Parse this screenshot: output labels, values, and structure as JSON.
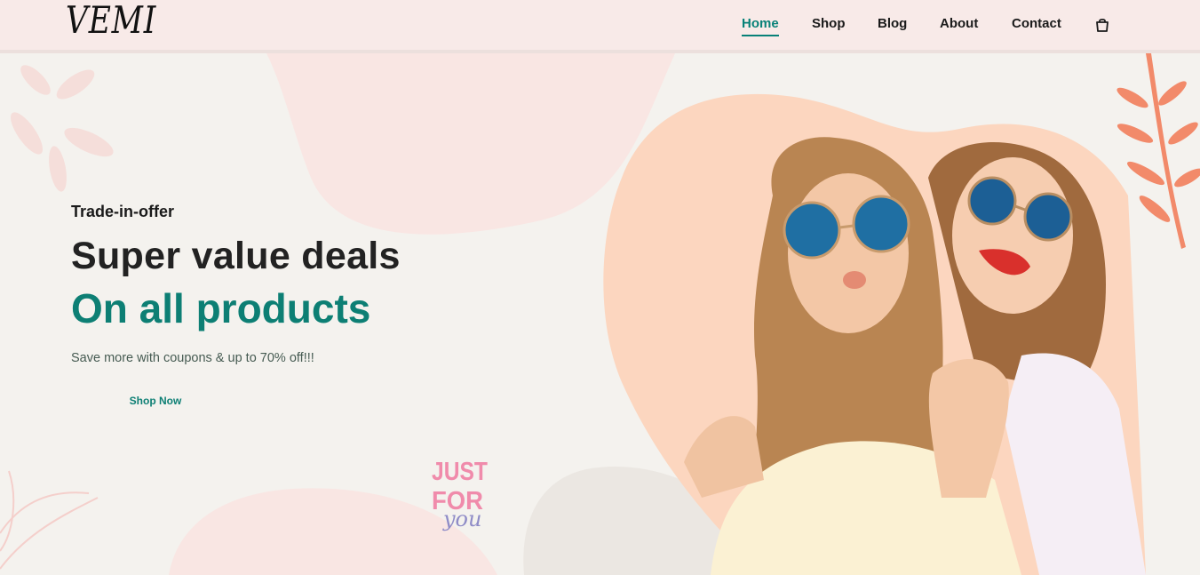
{
  "brand": {
    "logo_text": "VEMI"
  },
  "nav": {
    "items": [
      {
        "label": "Home",
        "active": true
      },
      {
        "label": "Shop",
        "active": false
      },
      {
        "label": "Blog",
        "active": false
      },
      {
        "label": "About",
        "active": false
      },
      {
        "label": "Contact",
        "active": false
      }
    ],
    "cart_icon": "shopping-bag-icon"
  },
  "hero": {
    "kicker": "Trade-in-offer",
    "headline": "Super value deals",
    "subheadline": "On all products",
    "description": "Save more with coupons & up to 70% off!!!",
    "cta_label": "Shop Now",
    "image_alt": "two-women-wearing-sunglasses-photo"
  },
  "stamp": {
    "line1": "JUST",
    "line2": "FOR",
    "line3": "you"
  },
  "colors": {
    "accent": "#088178",
    "header_bg": "#f8eae8",
    "page_bg": "#f4f2ee",
    "blob_peach": "#fcd9c4",
    "leaf_orange": "#f28a6a"
  }
}
